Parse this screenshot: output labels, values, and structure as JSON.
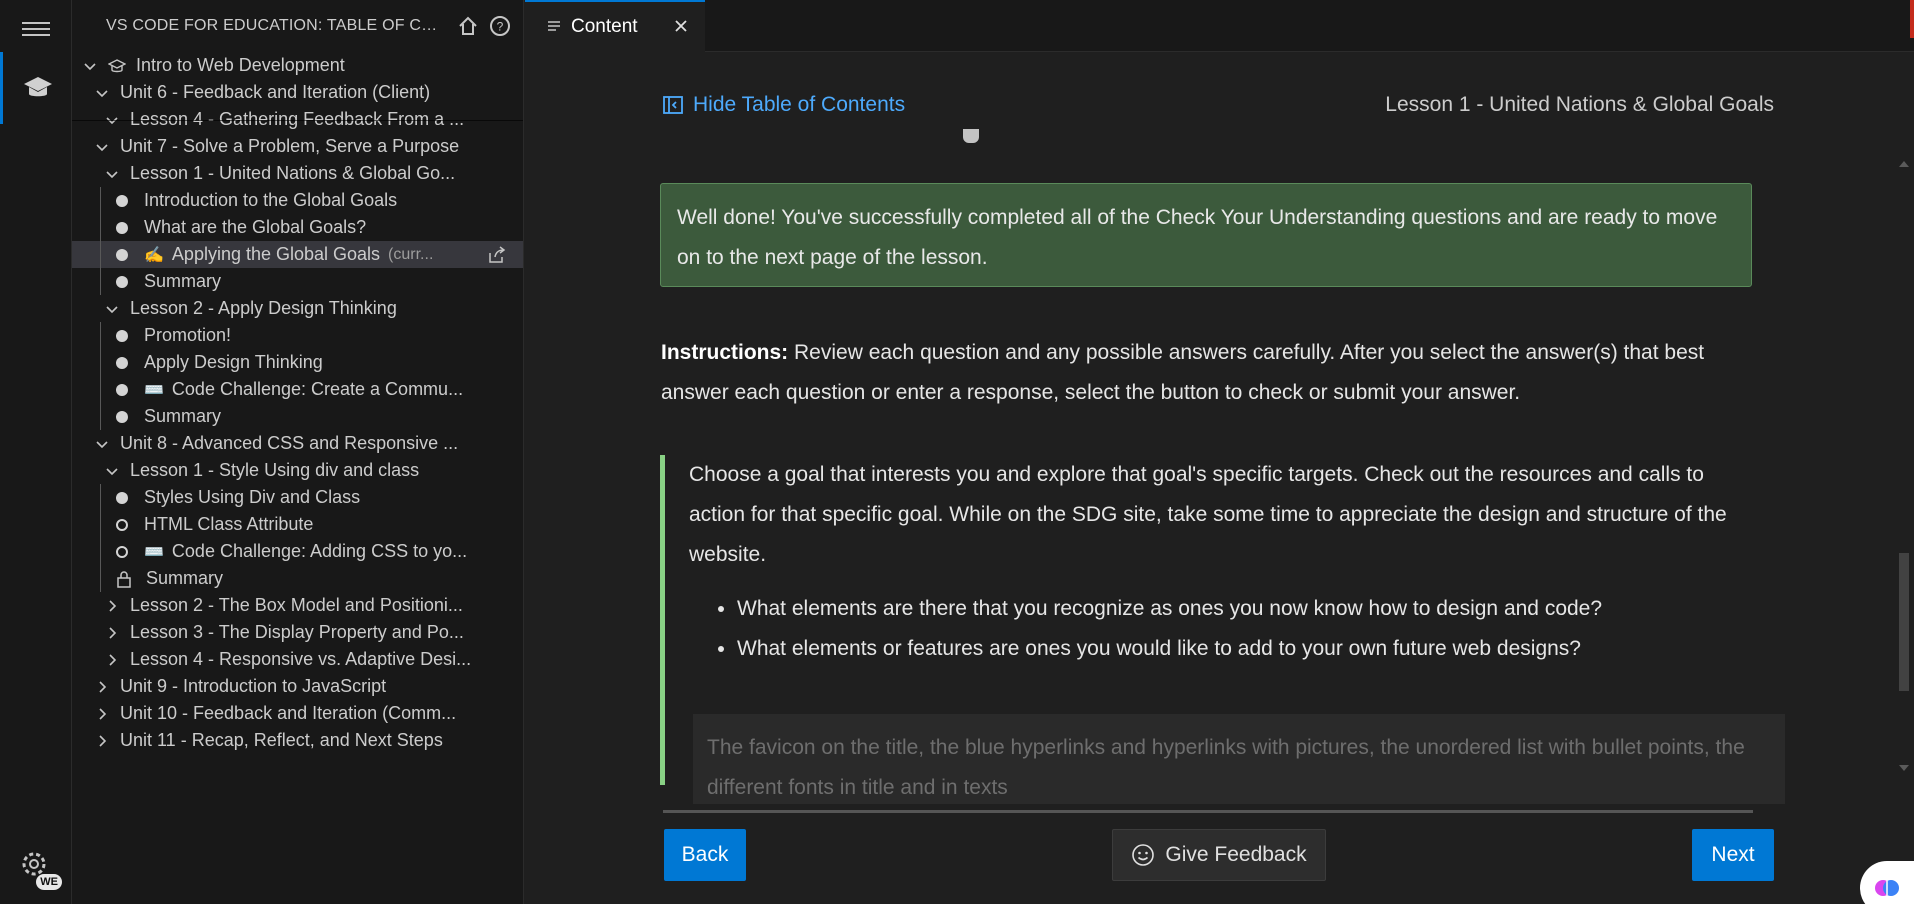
{
  "sidebar": {
    "title": "VS CODE FOR EDUCATION: TABLE OF CON...",
    "tree": [
      {
        "label": "Intro to Web Development",
        "indent": 0,
        "kind": "course"
      },
      {
        "label": "Unit 6 - Feedback and Iteration (Client)",
        "indent": 1,
        "kind": "open"
      },
      {
        "label": "Lesson 4 - Gathering Feedback From a ...",
        "indent": 2,
        "kind": "open"
      },
      {
        "label": "Unit 7 - Solve a Problem, Serve a Purpose",
        "indent": 1,
        "kind": "open"
      },
      {
        "label": "Lesson 1 - United Nations & Global Go...",
        "indent": 2,
        "kind": "open"
      },
      {
        "label": "Introduction to the Global Goals",
        "indent": 3,
        "kind": "done"
      },
      {
        "label": "What are the Global Goals?",
        "indent": 3,
        "kind": "done"
      },
      {
        "label": "Applying the Global Goals",
        "indent": 3,
        "kind": "current",
        "emoji": "✍️",
        "suffix": "(curr..."
      },
      {
        "label": "Summary",
        "indent": 3,
        "kind": "done"
      },
      {
        "label": "Lesson 2 - Apply Design Thinking",
        "indent": 2,
        "kind": "open"
      },
      {
        "label": "Promotion!",
        "indent": 3,
        "kind": "done"
      },
      {
        "label": "Apply Design Thinking",
        "indent": 3,
        "kind": "done"
      },
      {
        "label": "Code Challenge: Create a Commu...",
        "indent": 3,
        "kind": "done",
        "emoji": "⌨️"
      },
      {
        "label": "Summary",
        "indent": 3,
        "kind": "done"
      },
      {
        "label": "Unit 8 - Advanced CSS and Responsive ...",
        "indent": 1,
        "kind": "open"
      },
      {
        "label": "Lesson 1 - Style Using div and class",
        "indent": 2,
        "kind": "open"
      },
      {
        "label": "Styles Using Div and Class",
        "indent": 3,
        "kind": "done"
      },
      {
        "label": "HTML Class Attribute",
        "indent": 3,
        "kind": "todo"
      },
      {
        "label": "Code Challenge: Adding CSS to yo...",
        "indent": 3,
        "kind": "todo",
        "emoji": "⌨️"
      },
      {
        "label": "Summary",
        "indent": 3,
        "kind": "locked"
      },
      {
        "label": "Lesson 2 - The Box Model and Positioni...",
        "indent": 2,
        "kind": "closed"
      },
      {
        "label": "Lesson 3 - The Display Property and Po...",
        "indent": 2,
        "kind": "closed"
      },
      {
        "label": "Lesson 4 - Responsive vs. Adaptive Desi...",
        "indent": 2,
        "kind": "closed"
      },
      {
        "label": "Unit 9 - Introduction to JavaScript",
        "indent": 1,
        "kind": "closed"
      },
      {
        "label": "Unit 10 - Feedback and Iteration (Comm...",
        "indent": 1,
        "kind": "closed"
      },
      {
        "label": "Unit 11 - Recap, Reflect, and Next Steps",
        "indent": 1,
        "kind": "closed"
      }
    ]
  },
  "activity": {
    "badge": "WE"
  },
  "tab": {
    "label": "Content"
  },
  "content": {
    "toc_link": "Hide Table of Contents",
    "lesson_title": "Lesson 1 - United Nations & Global Goals",
    "success": "Well done! You've successfully completed all of the Check Your Understanding questions and are ready to move on to the next page of the lesson.",
    "instructions_label": "Instructions:",
    "instructions_text": " Review each question and any possible answers carefully. After you select the answer(s) that best answer each question or enter a response, select the button to check or submit your answer.",
    "question": "Choose a goal that interests you and explore that goal's specific targets. Check out the resources and calls to action for that specific goal. While on the SDG site, take some time to appreciate the design and structure of the website.",
    "bullets": [
      "What elements are there that you recognize as ones you now know how to design and code?",
      "What elements or features are ones you would like to add to your own future web designs?"
    ],
    "answer": "The favicon on the title, the blue hyperlinks and hyperlinks with pictures, the unordered list with bullet points, the different fonts in title and in texts"
  },
  "footer": {
    "back": "Back",
    "feedback": "Give Feedback",
    "next": "Next"
  }
}
